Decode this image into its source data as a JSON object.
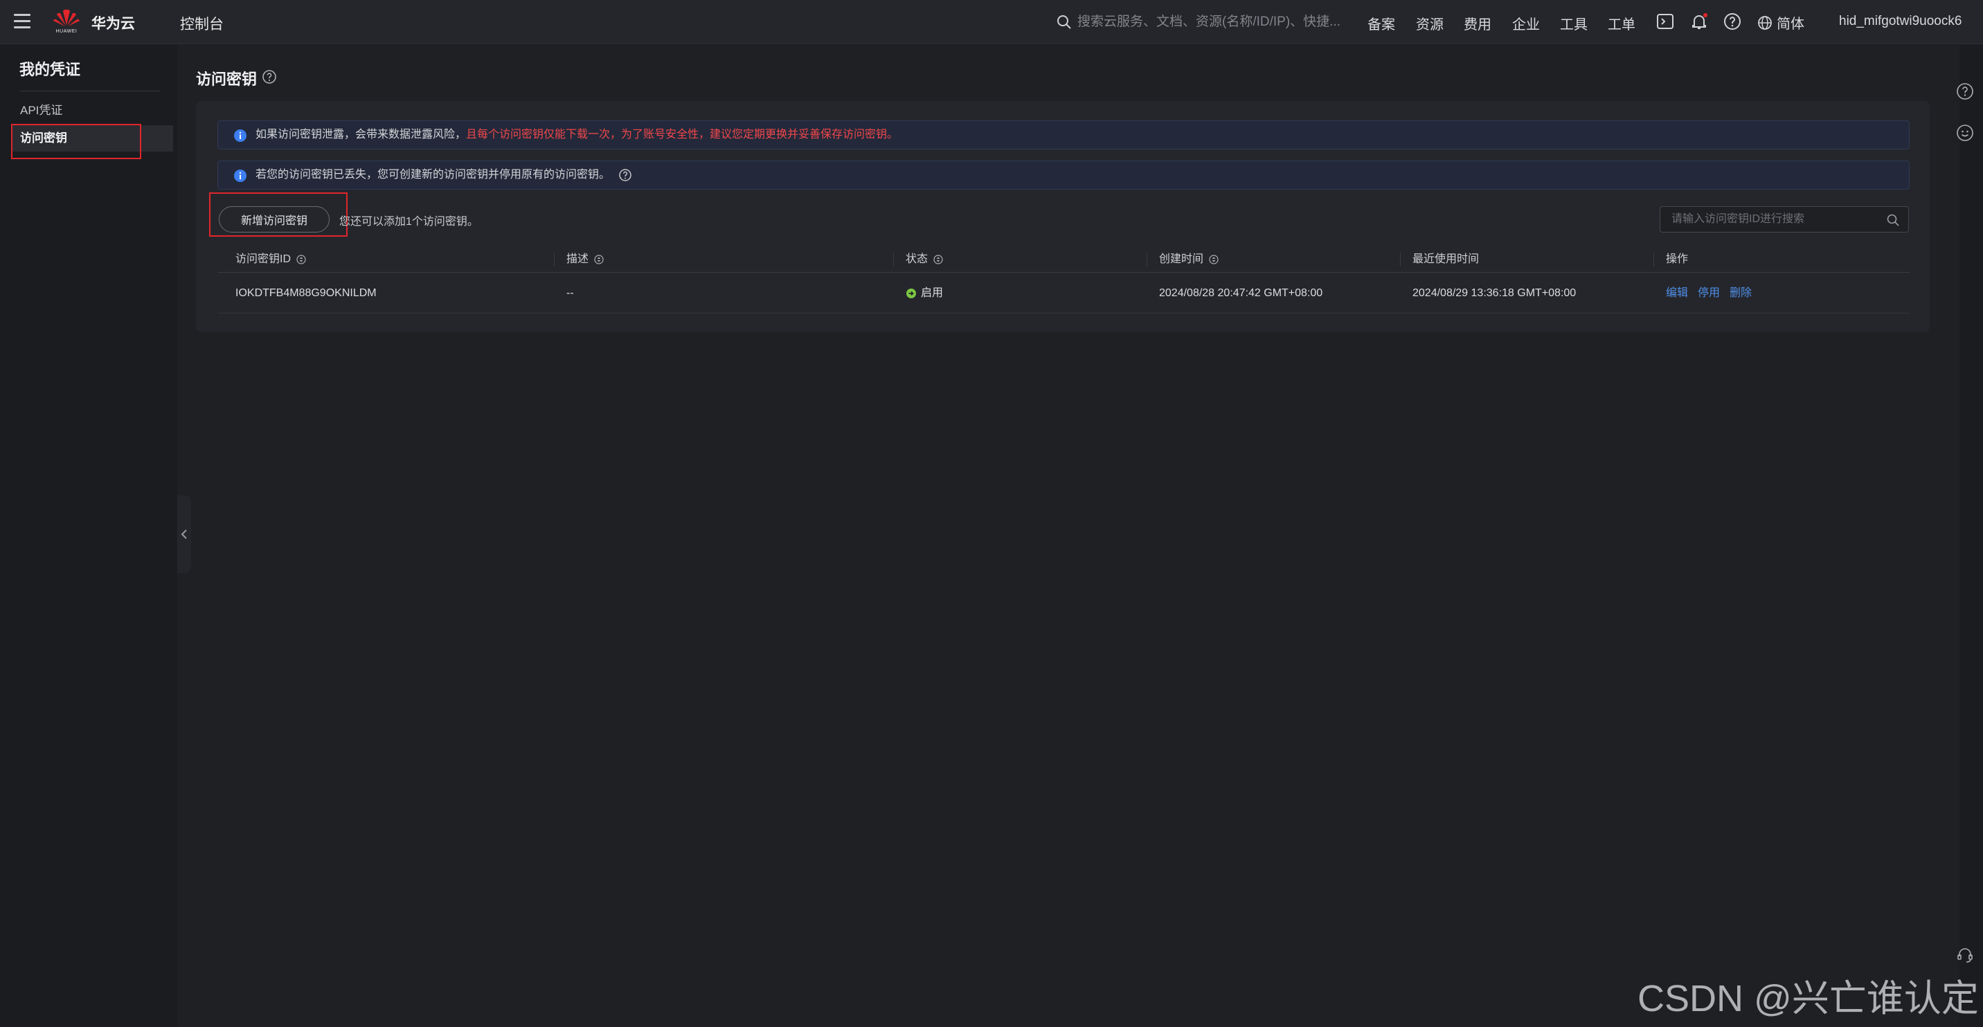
{
  "header": {
    "brand": "华为云",
    "logo_text": "HUAWEI",
    "console_label": "控制台",
    "search_placeholder": "搜索云服务、文档、资源(名称/ID/IP)、快捷...",
    "nav": [
      "备案",
      "资源",
      "费用",
      "企业",
      "工具",
      "工单"
    ],
    "language": "简体",
    "username": "hid_mifgotwi9uoock6",
    "icons": [
      "terminal-icon",
      "bell-icon",
      "help-icon",
      "globe-icon"
    ],
    "notification_dot_color": "#e0262b"
  },
  "sidebar": {
    "title": "我的凭证",
    "items": [
      {
        "label": "API凭证",
        "active": false
      },
      {
        "label": "访问密钥",
        "active": true
      }
    ]
  },
  "page": {
    "title": "访问密钥",
    "notices": [
      {
        "text": "如果访问密钥泄露，会带来数据泄露风险，",
        "warning": "且每个访问密钥仅能下载一次，为了账号安全性，建议您定期更换并妥善保存访问密钥。"
      },
      {
        "text": "若您的访问密钥已丢失，您可创建新的访问密钥并停用原有的访问密钥。",
        "warning": ""
      }
    ],
    "add_button": "新增访问密钥",
    "quota_text": "您还可以添加1个访问密钥。",
    "table_search_placeholder": "请输入访问密钥ID进行搜索"
  },
  "table": {
    "columns": [
      "访问密钥ID",
      "描述",
      "状态",
      "创建时间",
      "最近使用时间",
      "操作"
    ],
    "rows": [
      {
        "id": "IOKDTFB4M88G9OKNILDM",
        "description": "--",
        "status": "启用",
        "created": "2024/08/28 20:47:42 GMT+08:00",
        "last_used": "2024/08/29 13:36:18 GMT+08:00",
        "actions": [
          "编辑",
          "停用",
          "删除"
        ]
      }
    ]
  },
  "colors": {
    "accent_link": "#4f8fe8",
    "warning_text": "#f2474b",
    "status_enabled": "#7dc742",
    "highlight_box": "#e0262b"
  },
  "watermark": "CSDN @兴亡谁认定"
}
